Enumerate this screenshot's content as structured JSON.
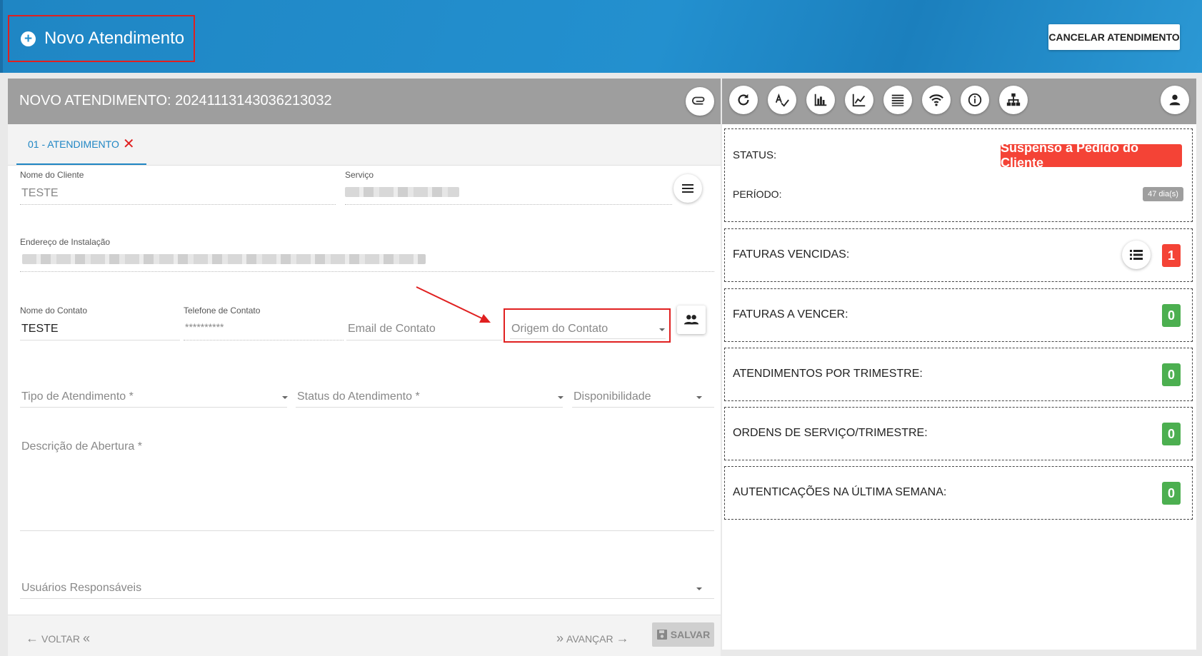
{
  "header": {
    "title": "Novo Atendimento",
    "cancel_label": "CANCELAR ATENDIMENTO"
  },
  "form": {
    "title": "NOVO ATENDIMENTO: 20241113143036213032",
    "tab_label": "01 - ATENDIMENTO",
    "nome_cliente_label": "Nome do Cliente",
    "nome_cliente_value": "TESTE",
    "servico_label": "Serviço",
    "endereco_label": "Endereço de Instalação",
    "nome_contato_label": "Nome do Contato",
    "nome_contato_value": "TESTE",
    "telefone_label": "Telefone de Contato",
    "telefone_value": "**********",
    "email_placeholder": "Email de Contato",
    "origem_placeholder": "Origem do Contato",
    "tipo_placeholder": "Tipo de Atendimento *",
    "status_placeholder": "Status do Atendimento *",
    "disponibilidade_placeholder": "Disponibilidade",
    "descricao_placeholder": "Descrição de Abertura *",
    "usuarios_placeholder": "Usuários Responsáveis",
    "voltar_label": "VOLTAR",
    "avancar_label": "AVANÇAR",
    "salvar_label": "SALVAR"
  },
  "summary": {
    "status_label": "STATUS:",
    "status_value": "Suspenso a Pedido do Cliente",
    "periodo_label": "PERÍODO:",
    "periodo_value": "47 dia(s)",
    "cards": [
      {
        "label": "FATURAS VENCIDAS:",
        "count": "1",
        "color": "#f44336"
      },
      {
        "label": "FATURAS A VENCER:",
        "count": "0",
        "color": "#4caf50"
      },
      {
        "label": "ATENDIMENTOS POR TRIMESTRE:",
        "count": "0",
        "color": "#4caf50"
      },
      {
        "label": "ORDENS DE SERVIÇO/TRIMESTRE:",
        "count": "0",
        "color": "#4caf50"
      },
      {
        "label": "AUTENTICAÇÕES NA ÚLTIMA SEMANA:",
        "count": "0",
        "color": "#4caf50"
      }
    ],
    "status_badge_color": "#f44336",
    "toolbar_icons": [
      "refresh-icon",
      "spellcheck-icon",
      "bar-chart-icon",
      "line-chart-icon",
      "list-icon",
      "wifi-icon",
      "info-icon",
      "sitemap-icon",
      "user-icon"
    ]
  },
  "colors": {
    "header_blue": "#2390cf",
    "panel_header_grey": "#9e9e9e",
    "highlight_red": "#e02020"
  }
}
